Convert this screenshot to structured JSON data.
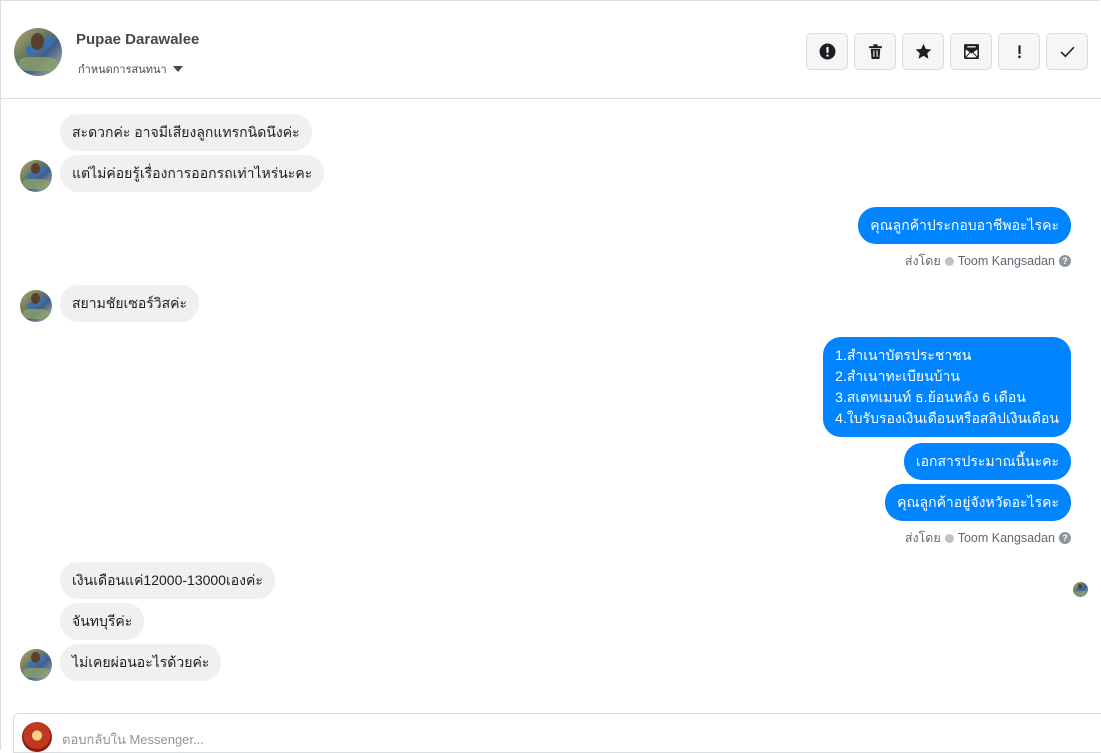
{
  "header": {
    "contact_name": "Pupae Darawalee",
    "conversation_setting": "กำหนดการสนทนา",
    "toolbar": [
      {
        "name": "alert-circle-icon",
        "label": "report"
      },
      {
        "name": "trash-icon",
        "label": "delete"
      },
      {
        "name": "star-icon",
        "label": "star"
      },
      {
        "name": "mail-icon",
        "label": "mark unread"
      },
      {
        "name": "exclamation-icon",
        "label": "spam"
      },
      {
        "name": "checkmark-icon",
        "label": "done"
      }
    ]
  },
  "messages": [
    {
      "dir": "in",
      "text": "สะดวกค่ะ อาจมีเสียงลูกแทรกนิดนึงค่ะ"
    },
    {
      "dir": "in",
      "text": "แต่ไม่ค่อยรู้เรื่องการออกรถเท่าไหร่นะคะ"
    },
    {
      "dir": "out",
      "text": "คุณลูกค้าประกอบอาชีพอะไรคะ"
    },
    {
      "dir": "in",
      "text": "สยามชัยเซอร์วิสค่ะ"
    },
    {
      "dir": "out",
      "lines": [
        "1.สำเนาบัตรประชาชน",
        "2.สำเนาทะเบียนบ้าน",
        "3.สเตทเมนท์ ธ.ย้อนหลัง 6 เดือน",
        "4.ใบรับรองเงินเดือนหรือสลิปเงินเดือน"
      ]
    },
    {
      "dir": "out",
      "text": "เอกสารประมาณนี้นะคะ"
    },
    {
      "dir": "out",
      "text": "คุณลูกค้าอยู่จังหวัดอะไรคะ"
    },
    {
      "dir": "in",
      "text": "เงินเดือนแค่12000-13000เองค่ะ"
    },
    {
      "dir": "in",
      "text": "จันทบุรีค่ะ"
    },
    {
      "dir": "in",
      "text": "ไม่เคยผ่อนอะไรด้วยค่ะ"
    }
  ],
  "sent_by": {
    "prefix": "ส่งโดย",
    "agent": "Toom Kangsadan"
  },
  "composer": {
    "placeholder": "ตอบกลับใน Messenger..."
  },
  "colors": {
    "outgoing_bubble": "#0084ff",
    "incoming_bubble": "#f0f0f0"
  }
}
